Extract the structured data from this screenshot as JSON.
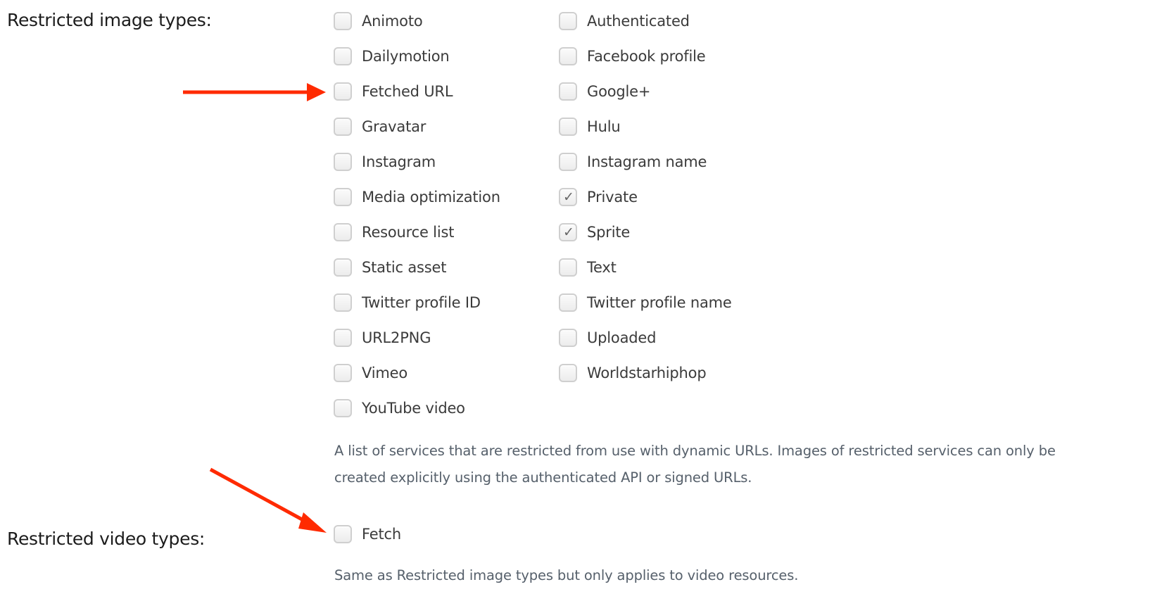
{
  "image_types": {
    "label": "Restricted image types:",
    "options": [
      {
        "label": "Animoto",
        "checked": false
      },
      {
        "label": "Authenticated",
        "checked": false
      },
      {
        "label": "Dailymotion",
        "checked": false
      },
      {
        "label": "Facebook profile",
        "checked": false
      },
      {
        "label": "Fetched URL",
        "checked": false
      },
      {
        "label": "Google+",
        "checked": false
      },
      {
        "label": "Gravatar",
        "checked": false
      },
      {
        "label": "Hulu",
        "checked": false
      },
      {
        "label": "Instagram",
        "checked": false
      },
      {
        "label": "Instagram name",
        "checked": false
      },
      {
        "label": "Media optimization",
        "checked": false
      },
      {
        "label": "Private",
        "checked": true
      },
      {
        "label": "Resource list",
        "checked": false
      },
      {
        "label": "Sprite",
        "checked": true
      },
      {
        "label": "Static asset",
        "checked": false
      },
      {
        "label": "Text",
        "checked": false
      },
      {
        "label": "Twitter profile ID",
        "checked": false
      },
      {
        "label": "Twitter profile name",
        "checked": false
      },
      {
        "label": "URL2PNG",
        "checked": false
      },
      {
        "label": "Uploaded",
        "checked": false
      },
      {
        "label": "Vimeo",
        "checked": false
      },
      {
        "label": "Worldstarhiphop",
        "checked": false
      },
      {
        "label": "YouTube video",
        "checked": false
      }
    ],
    "description_lines": [
      "A list of services that are restricted from use with dynamic URLs. Images of restricted services can only be",
      "created explicitly using the authenticated API or signed URLs."
    ]
  },
  "video_types": {
    "label": "Restricted video types:",
    "options": [
      {
        "label": "Fetch",
        "checked": false
      }
    ],
    "description": "Same as Restricted image types but only applies to video resources."
  },
  "annotations": {
    "arrow_color": "#ff2a00",
    "arrows": [
      {
        "points_to": "Fetched URL"
      },
      {
        "points_to": "Fetch"
      }
    ]
  },
  "icons": {
    "checkmark": "✓"
  }
}
